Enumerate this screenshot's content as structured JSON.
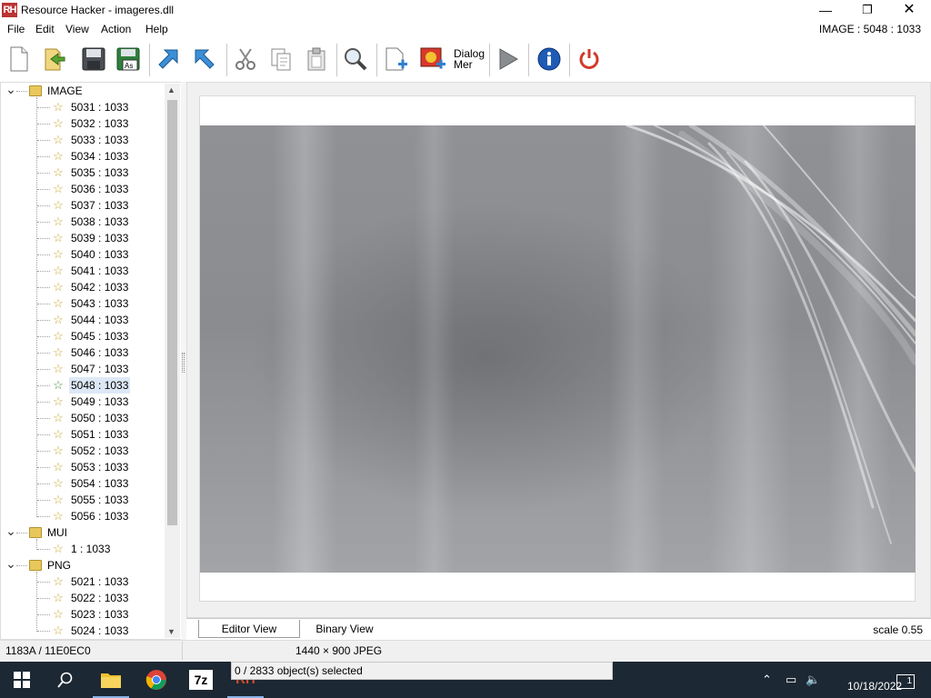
{
  "window": {
    "title": "Resource Hacker - imageres.dll",
    "logo": "RH",
    "minimize": "—",
    "maximize": "❐",
    "close": "✕"
  },
  "menu": [
    "File",
    "Edit",
    "View",
    "Action",
    "Help"
  ],
  "resource_id": "IMAGE : 5048 : 1033",
  "toolbar": {
    "dialog_menu_label": "Dialog\nMer",
    "icons": [
      "new-file-icon",
      "open-file-icon",
      "save-icon",
      "save-as-icon",
      "compile-left-icon",
      "compile-right-icon",
      "cut-icon",
      "copy-icon",
      "paste-icon",
      "find-icon",
      "add-resource-icon",
      "add-image-icon",
      "dialog-menu-icon",
      "run-script-icon",
      "info-icon",
      "power-icon"
    ]
  },
  "tree": {
    "groups": [
      {
        "name": "IMAGE",
        "items": [
          "5031 : 1033",
          "5032 : 1033",
          "5033 : 1033",
          "5034 : 1033",
          "5035 : 1033",
          "5036 : 1033",
          "5037 : 1033",
          "5038 : 1033",
          "5039 : 1033",
          "5040 : 1033",
          "5041 : 1033",
          "5042 : 1033",
          "5043 : 1033",
          "5044 : 1033",
          "5045 : 1033",
          "5046 : 1033",
          "5047 : 1033",
          "5048 : 1033",
          "5049 : 1033",
          "5050 : 1033",
          "5051 : 1033",
          "5052 : 1033",
          "5053 : 1033",
          "5054 : 1033",
          "5055 : 1033",
          "5056 : 1033"
        ],
        "selected": "5048 : 1033"
      },
      {
        "name": "MUI",
        "items": [
          "1 : 1033"
        ]
      },
      {
        "name": "PNG",
        "items": [
          "5021 : 1033",
          "5022 : 1033",
          "5023 : 1033",
          "5024 : 1033"
        ]
      }
    ]
  },
  "tabs": {
    "editor": "Editor View",
    "binary": "Binary View"
  },
  "scale": "scale 0.55",
  "status": {
    "offset": "1183A / 11E0EC0",
    "dims": "1440 × 900  JPEG",
    "selected": "0 / 2833 object(s) selected"
  },
  "taskbar": {
    "apps": [
      "windows-start",
      "search",
      "file-explorer",
      "chrome",
      "7zip",
      "resource-hacker"
    ],
    "rh_label": "RH",
    "zip_label": "7z",
    "date": "10/18/2022",
    "notification_count": "1"
  }
}
